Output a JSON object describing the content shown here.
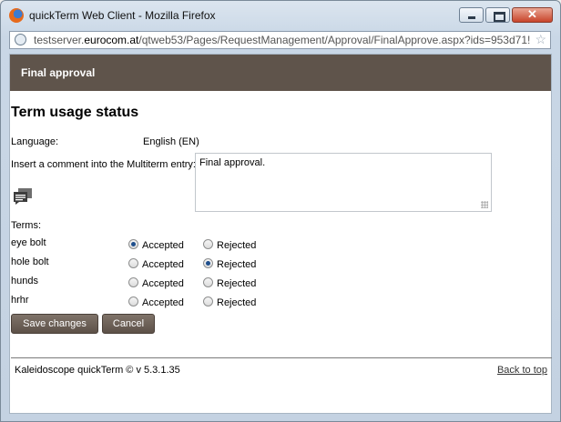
{
  "window": {
    "title": "quickTerm Web Client - Mozilla Firefox"
  },
  "address": {
    "prefix": "testserver.",
    "domain": "eurocom.at",
    "path": "/qtweb53/Pages/RequestManagement/Approval/FinalApprove.aspx?ids=953d71!"
  },
  "header": {
    "title": "Final approval"
  },
  "main": {
    "title": "Term usage status",
    "language_label": "Language:",
    "language_value": "English (EN)",
    "comment_label": "Insert a comment into the Multiterm entry:",
    "comment_value": "Final approval.",
    "terms_label": "Terms:",
    "accepted_label": "Accepted",
    "rejected_label": "Rejected",
    "terms": [
      {
        "name": "eye bolt",
        "status": "accepted"
      },
      {
        "name": "hole bolt",
        "status": "rejected"
      },
      {
        "name": "hunds",
        "status": "none"
      },
      {
        "name": "hrhr",
        "status": "none"
      }
    ],
    "save_label": "Save changes",
    "cancel_label": "Cancel"
  },
  "footer": {
    "copyright": "Kaleidoscope quickTerm © v 5.3.1.35",
    "back_to_top": "Back to top"
  }
}
